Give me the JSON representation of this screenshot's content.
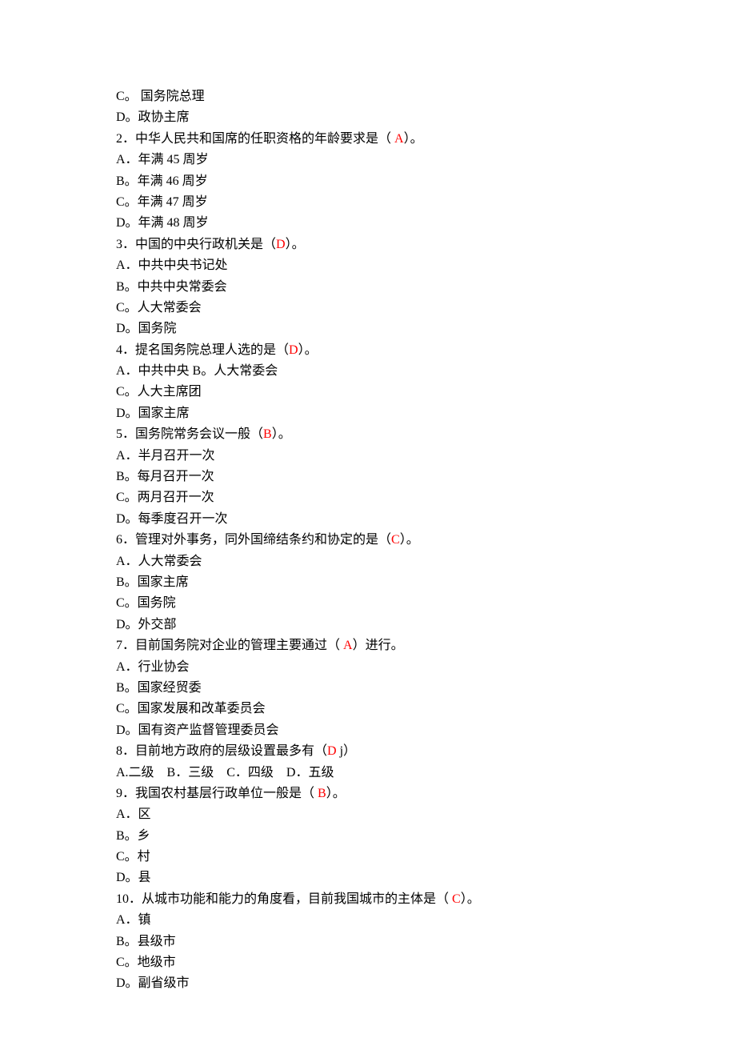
{
  "lines": [
    {
      "segments": [
        {
          "t": "C。 国务院总理"
        }
      ]
    },
    {
      "segments": [
        {
          "t": "D。政协主席"
        }
      ]
    },
    {
      "segments": [
        {
          "t": "2．中华人民共和国席的任职资格的年龄要求是（ "
        },
        {
          "t": "A",
          "c": "red"
        },
        {
          "t": "）。"
        }
      ]
    },
    {
      "segments": [
        {
          "t": "A．年满 45 周岁"
        }
      ]
    },
    {
      "segments": [
        {
          "t": "B。年满 46 周岁"
        }
      ]
    },
    {
      "segments": [
        {
          "t": "C。年满 47 周岁"
        }
      ]
    },
    {
      "segments": [
        {
          "t": "D。年满 48 周岁"
        }
      ]
    },
    {
      "segments": [
        {
          "t": "3．中国的中央行政机关是（"
        },
        {
          "t": "D",
          "c": "red"
        },
        {
          "t": "）。"
        }
      ]
    },
    {
      "segments": [
        {
          "t": "A．中共中央书记处"
        }
      ]
    },
    {
      "segments": [
        {
          "t": "B。中共中央常委会"
        }
      ]
    },
    {
      "segments": [
        {
          "t": "C。人大常委会"
        }
      ]
    },
    {
      "segments": [
        {
          "t": "D。国务院"
        }
      ]
    },
    {
      "segments": [
        {
          "t": "4．提名国务院总理人选的是（"
        },
        {
          "t": "D",
          "c": "red"
        },
        {
          "t": "）。"
        }
      ]
    },
    {
      "segments": [
        {
          "t": "A．中共中央 B。人大常委会"
        }
      ]
    },
    {
      "segments": [
        {
          "t": "C。人大主席团"
        }
      ]
    },
    {
      "segments": [
        {
          "t": "D。国家主席"
        }
      ]
    },
    {
      "segments": [
        {
          "t": "5．国务院常务会议一般（"
        },
        {
          "t": "B",
          "c": "red"
        },
        {
          "t": "）。"
        }
      ]
    },
    {
      "segments": [
        {
          "t": "A．半月召开一次"
        }
      ]
    },
    {
      "segments": [
        {
          "t": "B。每月召开一次"
        }
      ]
    },
    {
      "segments": [
        {
          "t": "C。两月召开一次"
        }
      ]
    },
    {
      "segments": [
        {
          "t": "D。每季度召开一次"
        }
      ]
    },
    {
      "segments": [
        {
          "t": "6．管理对外事务，同外国缔结条约和协定的是（"
        },
        {
          "t": "C",
          "c": "red"
        },
        {
          "t": "）。"
        }
      ]
    },
    {
      "segments": [
        {
          "t": "A．人大常委会"
        }
      ]
    },
    {
      "segments": [
        {
          "t": "B。国家主席"
        }
      ]
    },
    {
      "segments": [
        {
          "t": "C。国务院"
        }
      ]
    },
    {
      "segments": [
        {
          "t": "D。外交部"
        }
      ]
    },
    {
      "segments": [
        {
          "t": "7．目前国务院对企业的管理主要通过（ "
        },
        {
          "t": "A",
          "c": "red"
        },
        {
          "t": "）进行。"
        }
      ]
    },
    {
      "segments": [
        {
          "t": "A．行业协会"
        }
      ]
    },
    {
      "segments": [
        {
          "t": "B。国家经贸委"
        }
      ]
    },
    {
      "segments": [
        {
          "t": "C。国家发展和改革委员会"
        }
      ]
    },
    {
      "segments": [
        {
          "t": "D。国有资产监督管理委员会"
        }
      ]
    },
    {
      "segments": [
        {
          "t": "8．目前地方政府的层级设置最多有（"
        },
        {
          "t": "D",
          "c": "red"
        },
        {
          "t": " j）"
        }
      ]
    },
    {
      "segments": [
        {
          "t": "A.二级    B．三级    C．四级    D．五级"
        }
      ]
    },
    {
      "segments": [
        {
          "t": "9．我国农村基层行政单位一般是（ "
        },
        {
          "t": "B",
          "c": "red"
        },
        {
          "t": "）。"
        }
      ]
    },
    {
      "segments": [
        {
          "t": "A．区"
        }
      ]
    },
    {
      "segments": [
        {
          "t": "B。乡"
        }
      ]
    },
    {
      "segments": [
        {
          "t": "C。村"
        }
      ]
    },
    {
      "segments": [
        {
          "t": "D。县"
        }
      ]
    },
    {
      "segments": [
        {
          "t": "10．从城市功能和能力的角度看，目前我国城市的主体是（ "
        },
        {
          "t": "C",
          "c": "red"
        },
        {
          "t": "）。"
        }
      ]
    },
    {
      "segments": [
        {
          "t": "A．镇"
        }
      ]
    },
    {
      "segments": [
        {
          "t": "B。县级市"
        }
      ]
    },
    {
      "segments": [
        {
          "t": "C。地级市"
        }
      ]
    },
    {
      "segments": [
        {
          "t": "D。副省级市"
        }
      ]
    }
  ]
}
